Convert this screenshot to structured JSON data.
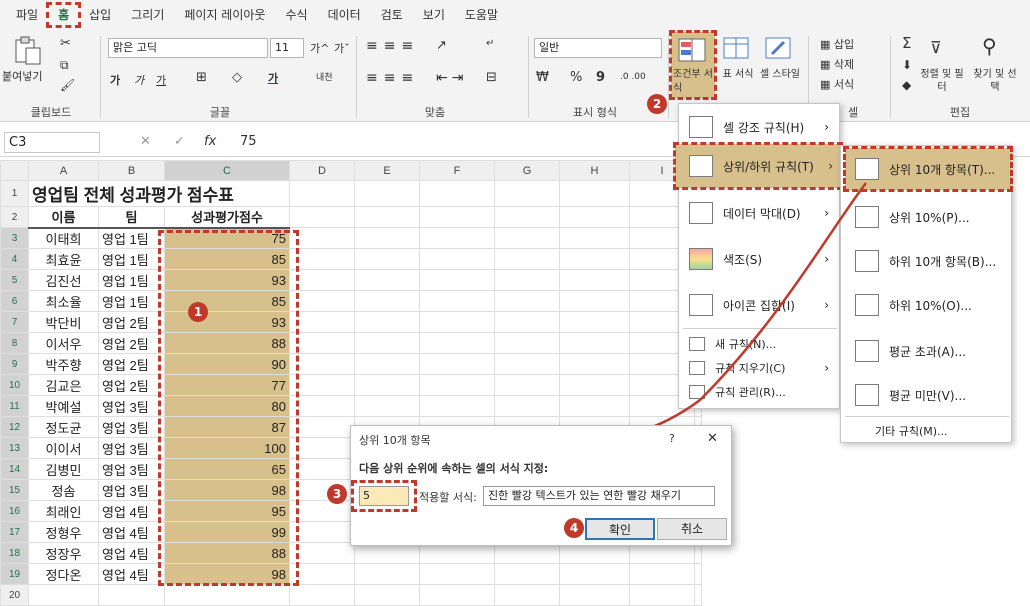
{
  "tabs": [
    "파일",
    "홈",
    "삽입",
    "그리기",
    "페이지 레이아웃",
    "수식",
    "데이터",
    "검토",
    "보기",
    "도움말"
  ],
  "ribbon": {
    "paste": "붙여넣기",
    "clipboard": "클립보드",
    "font_name": "맑은 고딕",
    "font_size": "11",
    "font_group": "글꼴",
    "align_group": "맞춤",
    "number_format": "일반",
    "number_group": "표시 형식",
    "cond_format": "조건부 서식",
    "table_format": "표 서식",
    "cell_style": "셀 스타일",
    "styles_group": "셀",
    "insert": "삽입",
    "delete": "삭제",
    "format": "서식",
    "sort_filter": "정렬 및 필터",
    "find_select": "찾기 및 선택",
    "edit_group": "편집",
    "bold": "가",
    "italic": "가",
    "underline": "가",
    "grow": "가^",
    "shrink": "가ˇ",
    "percent": "%",
    "comma": "9"
  },
  "formula_bar": {
    "name_box": "C3",
    "fx": "fx",
    "value": "75"
  },
  "sheet": {
    "columns": [
      "A",
      "B",
      "C",
      "D",
      "E",
      "F",
      "G",
      "H",
      "I"
    ],
    "title": "영업팀 전체 성과평가 점수표",
    "headers": [
      "이름",
      "팀",
      "성과평가점수"
    ],
    "rows": [
      [
        "이태희",
        "영업 1팀",
        "75"
      ],
      [
        "최효윤",
        "영업 1팀",
        "85"
      ],
      [
        "김진선",
        "영업 1팀",
        "93"
      ],
      [
        "최소율",
        "영업 1팀",
        "85"
      ],
      [
        "박단비",
        "영업 2팀",
        "93"
      ],
      [
        "이서우",
        "영업 2팀",
        "88"
      ],
      [
        "박주향",
        "영업 2팀",
        "90"
      ],
      [
        "김교은",
        "영업 2팀",
        "77"
      ],
      [
        "박예설",
        "영업 3팀",
        "80"
      ],
      [
        "정도균",
        "영업 3팀",
        "87"
      ],
      [
        "이이서",
        "영업 3팀",
        "100"
      ],
      [
        "김병민",
        "영업 3팀",
        "65"
      ],
      [
        "정솜",
        "영업 3팀",
        "98"
      ],
      [
        "최래인",
        "영업 4팀",
        "95"
      ],
      [
        "정형우",
        "영업 4팀",
        "99"
      ],
      [
        "정장우",
        "영업 4팀",
        "88"
      ],
      [
        "정다온",
        "영업 4팀",
        "98"
      ]
    ]
  },
  "menu": {
    "items": [
      "셀 강조 규칙(H)",
      "상위/하위 규칙(T)",
      "데이터 막대(D)",
      "색조(S)",
      "아이콘 집합(I)"
    ],
    "small_items": [
      "새 규칙(N)...",
      "규칙 지우기(C)",
      "규칙 관리(R)..."
    ]
  },
  "submenu": {
    "items": [
      "상위 10개 항목(T)...",
      "상위 10%(P)...",
      "하위 10개 항목(B)...",
      "하위 10%(O)...",
      "평균 초과(A)...",
      "평균 미만(V)..."
    ],
    "more": "기타 규칙(M)..."
  },
  "dialog": {
    "title": "상위 10개 항목",
    "help": "?",
    "close": "✕",
    "prompt": "다음 상위 순위에 속하는 셀의 서식 지정:",
    "count": "5",
    "apply_label": "적용할 서식:",
    "format": "진한 빨강 텍스트가 있는 연한 빨강 채우기",
    "ok": "확인",
    "cancel": "취소"
  },
  "badges": [
    "1",
    "2",
    "3",
    "4"
  ],
  "colors": {
    "highlight": "#d8c08c",
    "badge": "#c0392b",
    "accent": "#217346",
    "arrow": "#c0392b"
  }
}
